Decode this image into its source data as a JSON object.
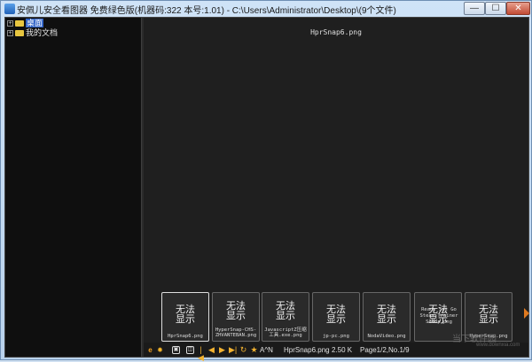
{
  "window": {
    "title": "安佩儿安全看图器 免费绿色版(机器码:322        本号:1.01) - C:\\Users\\Administrator\\Desktop\\(9个文件)",
    "min_label": "—",
    "max_label": "☐",
    "close_label": "✕"
  },
  "tree": {
    "items": [
      {
        "expander": "+",
        "label": "桌面",
        "selected": true
      },
      {
        "expander": "+",
        "label": "我的文档",
        "selected": false
      }
    ]
  },
  "viewer": {
    "current_file": "HprSnap6.png"
  },
  "thumbnails": [
    {
      "line1": "无法",
      "line2": "显示",
      "caption": "HprSnap6.png",
      "active": true
    },
    {
      "line1": "无法",
      "line2": "显示",
      "caption": "HyperSnap-CHS-ZHVANTEBAN.png"
    },
    {
      "line1": "无法",
      "line2": "显示",
      "caption": "JavascriptZ压缩工具.exe.png"
    },
    {
      "line1": "无法",
      "line2": "显示",
      "caption": "jp-pc.png"
    },
    {
      "line1": "无法",
      "line2": "显示",
      "caption": "NodaVideo.png"
    },
    {
      "line1": "无法",
      "line2": "显示",
      "caption": "Ready Set Go Steam Trainer Setup.png"
    },
    {
      "line1": "无法",
      "line2": "显示",
      "caption": "HyperSnap.png"
    }
  ],
  "status": {
    "icons": [
      "e-icon",
      "gear-icon",
      "print-icon",
      "prev-page-icon",
      "first-icon",
      "prev-icon",
      "next-icon",
      "last-icon",
      "rotate-icon",
      "star-icon"
    ],
    "sort_label": "A^N",
    "filename": "HprSnap6.png",
    "size": "2.50 K",
    "page_info": "Page1/2,No.1/9"
  },
  "watermark": {
    "main": "当下软件园",
    "url": "www.downxia.com"
  },
  "colors": {
    "selection": "#2f62c6",
    "folder": "#e8c640",
    "accent": "#e07a20"
  }
}
